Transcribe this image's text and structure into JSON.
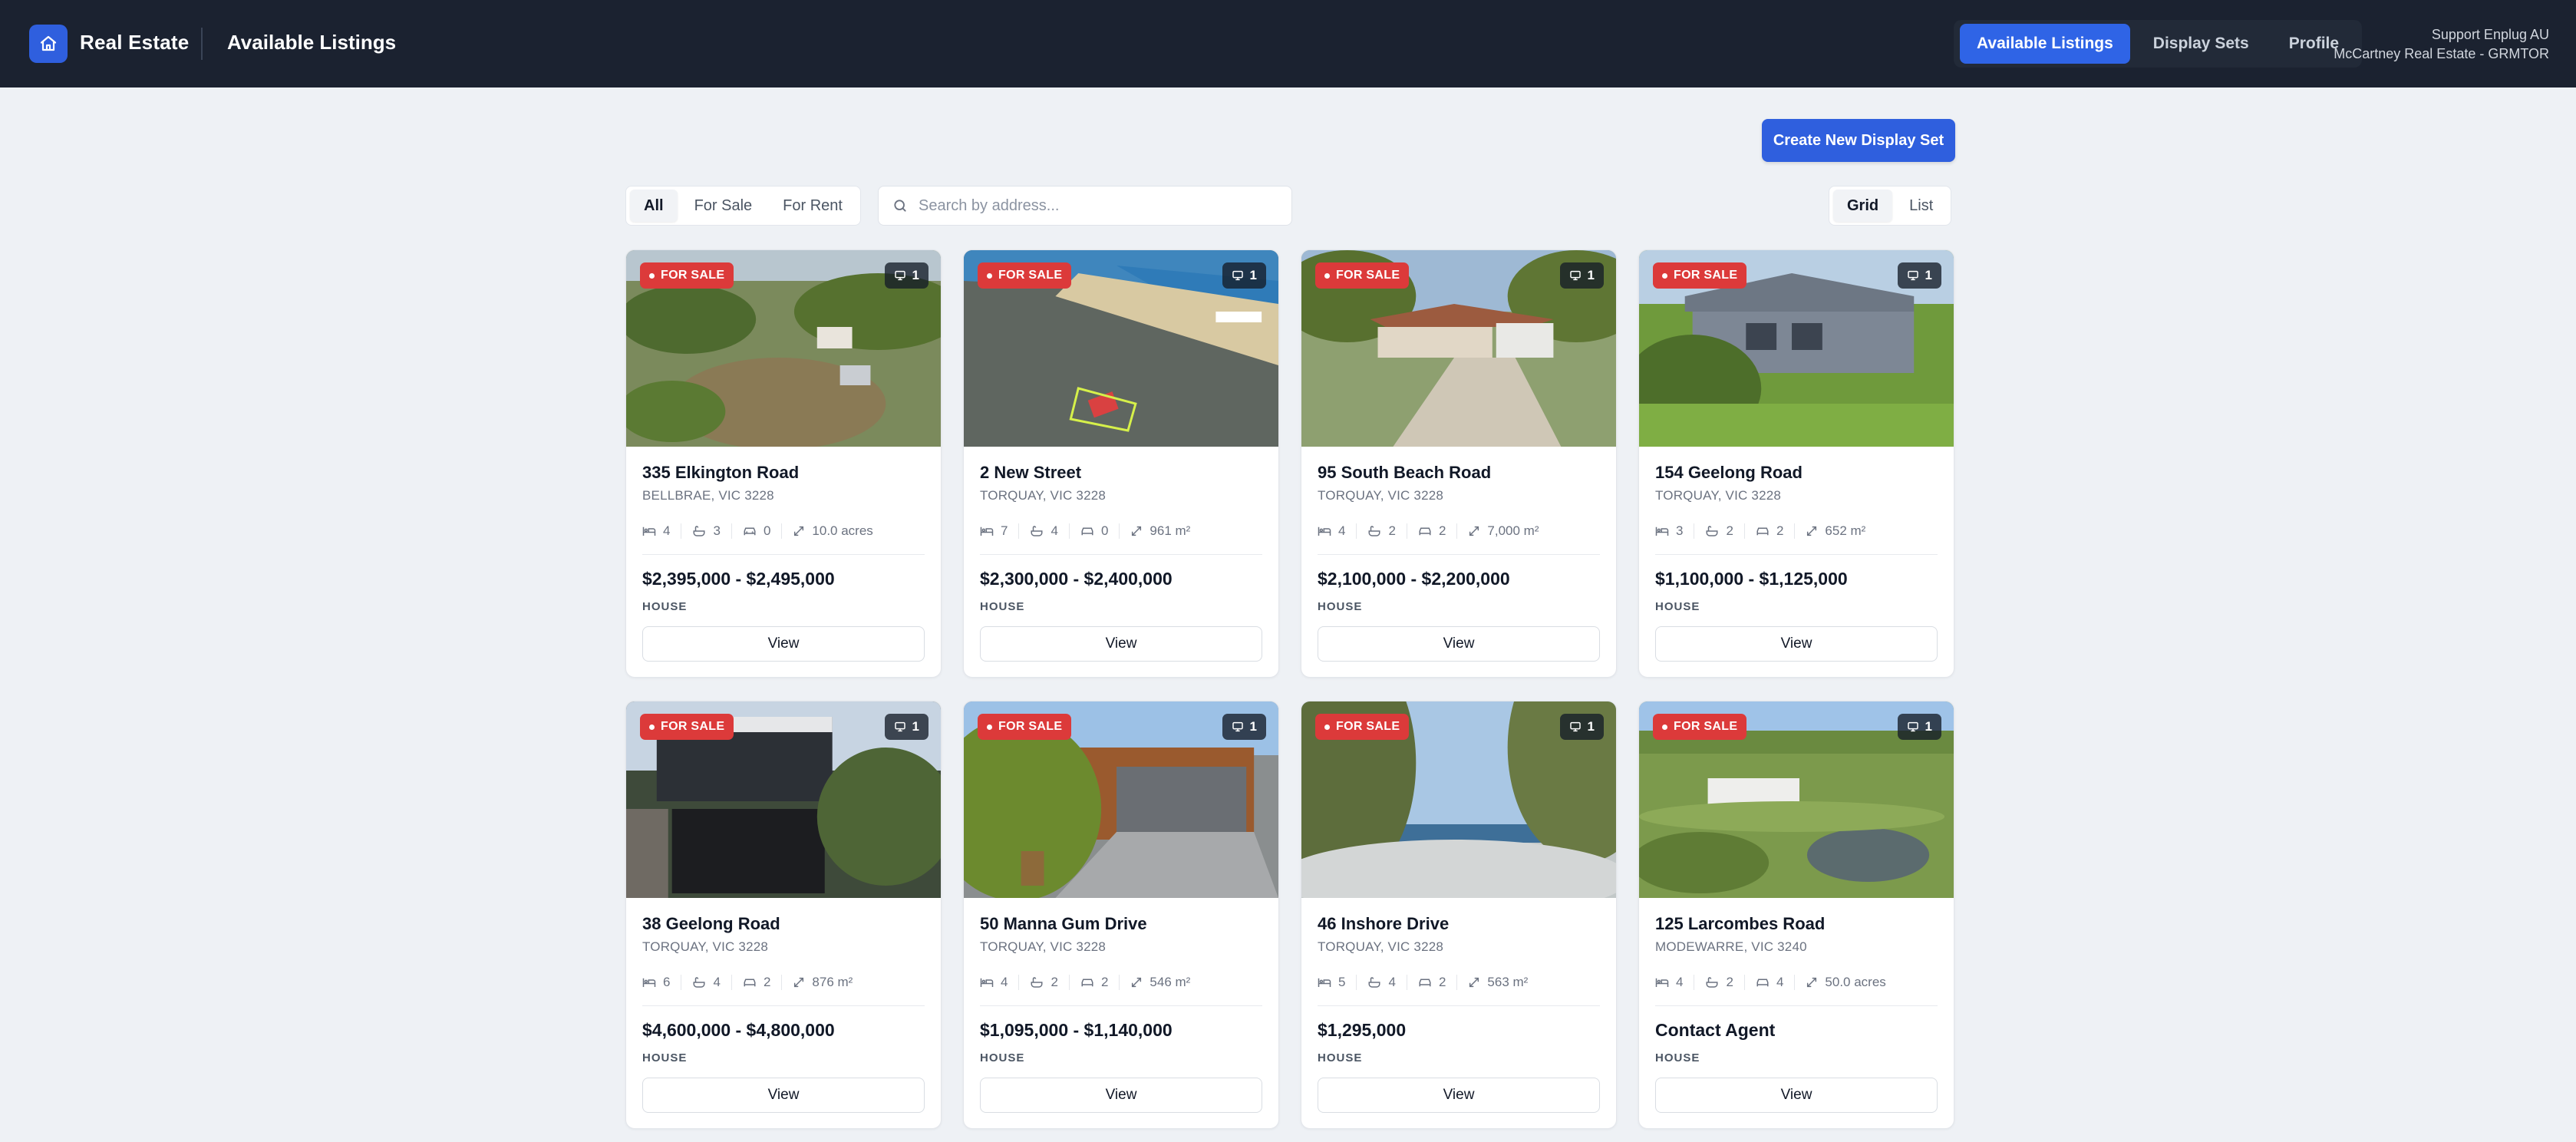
{
  "header": {
    "brand": "Real Estate",
    "page_title": "Available Listings",
    "nav": [
      {
        "label": "Available Listings",
        "active": true
      },
      {
        "label": "Display Sets",
        "active": false
      },
      {
        "label": "Profile",
        "active": false
      }
    ],
    "user_line1": "Support Enplug AU",
    "user_line2": "McCartney Real Estate - GRMTOR"
  },
  "toolbar": {
    "create_label": "Create New Display Set",
    "filters": [
      {
        "label": "All",
        "active": true
      },
      {
        "label": "For Sale",
        "active": false
      },
      {
        "label": "For Rent",
        "active": false
      }
    ],
    "search_placeholder": "Search by address...",
    "views": [
      {
        "label": "Grid",
        "active": true
      },
      {
        "label": "List",
        "active": false
      }
    ]
  },
  "listings": [
    {
      "status": "FOR SALE",
      "count": "1",
      "address": "335 Elkington Road",
      "suburb": "BELLBRAE, VIC 3228",
      "beds": "4",
      "baths": "3",
      "cars": "0",
      "area": "10.0 acres",
      "price": "$2,395,000 - $2,495,000",
      "type": "HOUSE",
      "view_label": "View"
    },
    {
      "status": "FOR SALE",
      "count": "1",
      "address": "2 New Street",
      "suburb": "TORQUAY, VIC 3228",
      "beds": "7",
      "baths": "4",
      "cars": "0",
      "area": "961 m²",
      "price": "$2,300,000 - $2,400,000",
      "type": "HOUSE",
      "view_label": "View"
    },
    {
      "status": "FOR SALE",
      "count": "1",
      "address": "95 South Beach Road",
      "suburb": "TORQUAY, VIC 3228",
      "beds": "4",
      "baths": "2",
      "cars": "2",
      "area": "7,000 m²",
      "price": "$2,100,000 - $2,200,000",
      "type": "HOUSE",
      "view_label": "View"
    },
    {
      "status": "FOR SALE",
      "count": "1",
      "address": "154 Geelong Road",
      "suburb": "TORQUAY, VIC 3228",
      "beds": "3",
      "baths": "2",
      "cars": "2",
      "area": "652 m²",
      "price": "$1,100,000 - $1,125,000",
      "type": "HOUSE",
      "view_label": "View"
    },
    {
      "status": "FOR SALE",
      "count": "1",
      "address": "38 Geelong Road",
      "suburb": "TORQUAY, VIC 3228",
      "beds": "6",
      "baths": "4",
      "cars": "2",
      "area": "876 m²",
      "price": "$4,600,000 - $4,800,000",
      "type": "HOUSE",
      "view_label": "View"
    },
    {
      "status": "FOR SALE",
      "count": "1",
      "address": "50 Manna Gum Drive",
      "suburb": "TORQUAY, VIC 3228",
      "beds": "4",
      "baths": "2",
      "cars": "2",
      "area": "546 m²",
      "price": "$1,095,000 - $1,140,000",
      "type": "HOUSE",
      "view_label": "View"
    },
    {
      "status": "FOR SALE",
      "count": "1",
      "address": "46 Inshore Drive",
      "suburb": "TORQUAY, VIC 3228",
      "beds": "5",
      "baths": "4",
      "cars": "2",
      "area": "563 m²",
      "price": "$1,295,000",
      "type": "HOUSE",
      "view_label": "View"
    },
    {
      "status": "FOR SALE",
      "count": "1",
      "address": "125 Larcombes Road",
      "suburb": "MODEWARRE, VIC 3240",
      "beds": "4",
      "baths": "2",
      "cars": "4",
      "area": "50.0 acres",
      "price": "Contact Agent",
      "type": "HOUSE",
      "view_label": "View"
    }
  ],
  "colors": {
    "header_bg": "#1b2230",
    "accent": "#2f5fde",
    "sale_badge": "#dc3a3a",
    "page_bg": "#eef1f5"
  }
}
